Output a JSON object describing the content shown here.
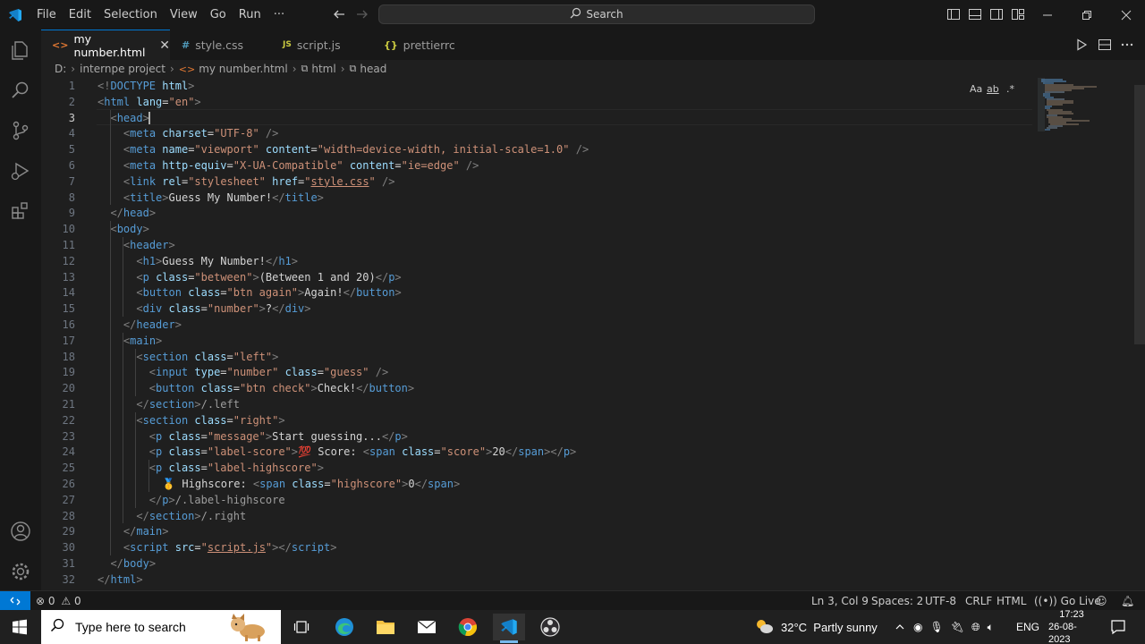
{
  "menu": [
    "File",
    "Edit",
    "Selection",
    "View",
    "Go",
    "Run",
    "···"
  ],
  "search": {
    "label": "Search"
  },
  "tabs": [
    {
      "label": "my number.html",
      "icon": "<>",
      "active": true
    },
    {
      "label": "style.css",
      "icon": "#"
    },
    {
      "label": "script.js",
      "icon": "JS"
    },
    {
      "label": "prettierrc",
      "icon": "{}"
    }
  ],
  "breadcrumb": [
    "D:",
    "internpe project",
    "my number.html",
    "html",
    "head"
  ],
  "find_widget": [
    "Aa",
    "ab",
    ".*"
  ],
  "code_lines": [
    [
      [
        "pu",
        "<!"
      ],
      [
        "tg",
        "DOCTYPE"
      ],
      [
        "tx",
        " "
      ],
      [
        "at",
        "html"
      ],
      [
        "pu",
        ">"
      ]
    ],
    [
      [
        "pu",
        "<"
      ],
      [
        "tg",
        "html"
      ],
      [
        "tx",
        " "
      ],
      [
        "at",
        "lang"
      ],
      [
        "tx",
        "="
      ],
      [
        "st",
        "\"en\""
      ],
      [
        "pu",
        ">"
      ]
    ],
    [
      [
        "tx",
        "  "
      ],
      [
        "pu",
        "<"
      ],
      [
        "tg",
        "head"
      ],
      [
        "pu",
        ">"
      ]
    ],
    [
      [
        "tx",
        "    "
      ],
      [
        "pu",
        "<"
      ],
      [
        "tg",
        "meta"
      ],
      [
        "tx",
        " "
      ],
      [
        "at",
        "charset"
      ],
      [
        "tx",
        "="
      ],
      [
        "st",
        "\"UTF-8\""
      ],
      [
        "tx",
        " "
      ],
      [
        "pu",
        "/>"
      ]
    ],
    [
      [
        "tx",
        "    "
      ],
      [
        "pu",
        "<"
      ],
      [
        "tg",
        "meta"
      ],
      [
        "tx",
        " "
      ],
      [
        "at",
        "name"
      ],
      [
        "tx",
        "="
      ],
      [
        "st",
        "\"viewport\""
      ],
      [
        "tx",
        " "
      ],
      [
        "at",
        "content"
      ],
      [
        "tx",
        "="
      ],
      [
        "st",
        "\"width=device-width, initial-scale=1.0\""
      ],
      [
        "tx",
        " "
      ],
      [
        "pu",
        "/>"
      ]
    ],
    [
      [
        "tx",
        "    "
      ],
      [
        "pu",
        "<"
      ],
      [
        "tg",
        "meta"
      ],
      [
        "tx",
        " "
      ],
      [
        "at",
        "http-equiv"
      ],
      [
        "tx",
        "="
      ],
      [
        "st",
        "\"X-UA-Compatible\""
      ],
      [
        "tx",
        " "
      ],
      [
        "at",
        "content"
      ],
      [
        "tx",
        "="
      ],
      [
        "st",
        "\"ie=edge\""
      ],
      [
        "tx",
        " "
      ],
      [
        "pu",
        "/>"
      ]
    ],
    [
      [
        "tx",
        "    "
      ],
      [
        "pu",
        "<"
      ],
      [
        "tg",
        "link"
      ],
      [
        "tx",
        " "
      ],
      [
        "at",
        "rel"
      ],
      [
        "tx",
        "="
      ],
      [
        "st",
        "\"stylesheet\""
      ],
      [
        "tx",
        " "
      ],
      [
        "at",
        "href"
      ],
      [
        "tx",
        "="
      ],
      [
        "st",
        "\""
      ],
      [
        "stu",
        "style.css"
      ],
      [
        "st",
        "\""
      ],
      [
        "tx",
        " "
      ],
      [
        "pu",
        "/>"
      ]
    ],
    [
      [
        "tx",
        "    "
      ],
      [
        "pu",
        "<"
      ],
      [
        "tg",
        "title"
      ],
      [
        "pu",
        ">"
      ],
      [
        "tx",
        "Guess My Number!"
      ],
      [
        "pu",
        "</"
      ],
      [
        "tg",
        "title"
      ],
      [
        "pu",
        ">"
      ]
    ],
    [
      [
        "tx",
        "  "
      ],
      [
        "pu",
        "</"
      ],
      [
        "tg",
        "head"
      ],
      [
        "pu",
        ">"
      ]
    ],
    [
      [
        "tx",
        "  "
      ],
      [
        "pu",
        "<"
      ],
      [
        "tg",
        "body"
      ],
      [
        "pu",
        ">"
      ]
    ],
    [
      [
        "tx",
        "    "
      ],
      [
        "pu",
        "<"
      ],
      [
        "tg",
        "header"
      ],
      [
        "pu",
        ">"
      ]
    ],
    [
      [
        "tx",
        "      "
      ],
      [
        "pu",
        "<"
      ],
      [
        "tg",
        "h1"
      ],
      [
        "pu",
        ">"
      ],
      [
        "tx",
        "Guess My Number!"
      ],
      [
        "pu",
        "</"
      ],
      [
        "tg",
        "h1"
      ],
      [
        "pu",
        ">"
      ]
    ],
    [
      [
        "tx",
        "      "
      ],
      [
        "pu",
        "<"
      ],
      [
        "tg",
        "p"
      ],
      [
        "tx",
        " "
      ],
      [
        "at",
        "class"
      ],
      [
        "tx",
        "="
      ],
      [
        "st",
        "\"between\""
      ],
      [
        "pu",
        ">"
      ],
      [
        "tx",
        "(Between 1 and 20)"
      ],
      [
        "pu",
        "</"
      ],
      [
        "tg",
        "p"
      ],
      [
        "pu",
        ">"
      ]
    ],
    [
      [
        "tx",
        "      "
      ],
      [
        "pu",
        "<"
      ],
      [
        "tg",
        "button"
      ],
      [
        "tx",
        " "
      ],
      [
        "at",
        "class"
      ],
      [
        "tx",
        "="
      ],
      [
        "st",
        "\"btn again\""
      ],
      [
        "pu",
        ">"
      ],
      [
        "tx",
        "Again!"
      ],
      [
        "pu",
        "</"
      ],
      [
        "tg",
        "button"
      ],
      [
        "pu",
        ">"
      ]
    ],
    [
      [
        "tx",
        "      "
      ],
      [
        "pu",
        "<"
      ],
      [
        "tg",
        "div"
      ],
      [
        "tx",
        " "
      ],
      [
        "at",
        "class"
      ],
      [
        "tx",
        "="
      ],
      [
        "st",
        "\"number\""
      ],
      [
        "pu",
        ">"
      ],
      [
        "tx",
        "?"
      ],
      [
        "pu",
        "</"
      ],
      [
        "tg",
        "div"
      ],
      [
        "pu",
        ">"
      ]
    ],
    [
      [
        "tx",
        "    "
      ],
      [
        "pu",
        "</"
      ],
      [
        "tg",
        "header"
      ],
      [
        "pu",
        ">"
      ]
    ],
    [
      [
        "tx",
        "    "
      ],
      [
        "pu",
        "<"
      ],
      [
        "tg",
        "main"
      ],
      [
        "pu",
        ">"
      ]
    ],
    [
      [
        "tx",
        "      "
      ],
      [
        "pu",
        "<"
      ],
      [
        "tg",
        "section"
      ],
      [
        "tx",
        " "
      ],
      [
        "at",
        "class"
      ],
      [
        "tx",
        "="
      ],
      [
        "st",
        "\"left\""
      ],
      [
        "pu",
        ">"
      ]
    ],
    [
      [
        "tx",
        "        "
      ],
      [
        "pu",
        "<"
      ],
      [
        "tg",
        "input"
      ],
      [
        "tx",
        " "
      ],
      [
        "at",
        "type"
      ],
      [
        "tx",
        "="
      ],
      [
        "st",
        "\"number\""
      ],
      [
        "tx",
        " "
      ],
      [
        "at",
        "class"
      ],
      [
        "tx",
        "="
      ],
      [
        "st",
        "\"guess\""
      ],
      [
        "tx",
        " "
      ],
      [
        "pu",
        "/>"
      ]
    ],
    [
      [
        "tx",
        "        "
      ],
      [
        "pu",
        "<"
      ],
      [
        "tg",
        "button"
      ],
      [
        "tx",
        " "
      ],
      [
        "at",
        "class"
      ],
      [
        "tx",
        "="
      ],
      [
        "st",
        "\"btn check\""
      ],
      [
        "pu",
        ">"
      ],
      [
        "tx",
        "Check!"
      ],
      [
        "pu",
        "</"
      ],
      [
        "tg",
        "button"
      ],
      [
        "pu",
        ">"
      ]
    ],
    [
      [
        "tx",
        "      "
      ],
      [
        "pu",
        "</"
      ],
      [
        "tg",
        "section"
      ],
      [
        "pu",
        ">"
      ],
      [
        "cm",
        "/.left"
      ]
    ],
    [
      [
        "tx",
        "      "
      ],
      [
        "pu",
        "<"
      ],
      [
        "tg",
        "section"
      ],
      [
        "tx",
        " "
      ],
      [
        "at",
        "class"
      ],
      [
        "tx",
        "="
      ],
      [
        "st",
        "\"right\""
      ],
      [
        "pu",
        ">"
      ]
    ],
    [
      [
        "tx",
        "        "
      ],
      [
        "pu",
        "<"
      ],
      [
        "tg",
        "p"
      ],
      [
        "tx",
        " "
      ],
      [
        "at",
        "class"
      ],
      [
        "tx",
        "="
      ],
      [
        "st",
        "\"message\""
      ],
      [
        "pu",
        ">"
      ],
      [
        "tx",
        "Start guessing..."
      ],
      [
        "pu",
        "</"
      ],
      [
        "tg",
        "p"
      ],
      [
        "pu",
        ">"
      ]
    ],
    [
      [
        "tx",
        "        "
      ],
      [
        "pu",
        "<"
      ],
      [
        "tg",
        "p"
      ],
      [
        "tx",
        " "
      ],
      [
        "at",
        "class"
      ],
      [
        "tx",
        "="
      ],
      [
        "st",
        "\"label-score\""
      ],
      [
        "pu",
        ">"
      ],
      [
        "emr",
        "💯"
      ],
      [
        "tx",
        " Score: "
      ],
      [
        "pu",
        "<"
      ],
      [
        "tg",
        "span"
      ],
      [
        "tx",
        " "
      ],
      [
        "at",
        "class"
      ],
      [
        "tx",
        "="
      ],
      [
        "st",
        "\"score\""
      ],
      [
        "pu",
        ">"
      ],
      [
        "tx",
        "20"
      ],
      [
        "pu",
        "</"
      ],
      [
        "tg",
        "span"
      ],
      [
        "pu",
        ">"
      ],
      [
        "pu",
        "</"
      ],
      [
        "tg",
        "p"
      ],
      [
        "pu",
        ">"
      ]
    ],
    [
      [
        "tx",
        "        "
      ],
      [
        "pu",
        "<"
      ],
      [
        "tg",
        "p"
      ],
      [
        "tx",
        " "
      ],
      [
        "at",
        "class"
      ],
      [
        "tx",
        "="
      ],
      [
        "st",
        "\"label-highscore\""
      ],
      [
        "pu",
        ">"
      ]
    ],
    [
      [
        "tx",
        "          "
      ],
      [
        "emy",
        "🥇"
      ],
      [
        "tx",
        " Highscore: "
      ],
      [
        "pu",
        "<"
      ],
      [
        "tg",
        "span"
      ],
      [
        "tx",
        " "
      ],
      [
        "at",
        "class"
      ],
      [
        "tx",
        "="
      ],
      [
        "st",
        "\"highscore\""
      ],
      [
        "pu",
        ">"
      ],
      [
        "tx",
        "0"
      ],
      [
        "pu",
        "</"
      ],
      [
        "tg",
        "span"
      ],
      [
        "pu",
        ">"
      ]
    ],
    [
      [
        "tx",
        "        "
      ],
      [
        "pu",
        "</"
      ],
      [
        "tg",
        "p"
      ],
      [
        "pu",
        ">"
      ],
      [
        "cm",
        "/.label-highscore"
      ]
    ],
    [
      [
        "tx",
        "      "
      ],
      [
        "pu",
        "</"
      ],
      [
        "tg",
        "section"
      ],
      [
        "pu",
        ">"
      ],
      [
        "cm",
        "/.right"
      ]
    ],
    [
      [
        "tx",
        "    "
      ],
      [
        "pu",
        "</"
      ],
      [
        "tg",
        "main"
      ],
      [
        "pu",
        ">"
      ]
    ],
    [
      [
        "tx",
        "    "
      ],
      [
        "pu",
        "<"
      ],
      [
        "tg",
        "script"
      ],
      [
        "tx",
        " "
      ],
      [
        "at",
        "src"
      ],
      [
        "tx",
        "="
      ],
      [
        "st",
        "\""
      ],
      [
        "stu",
        "script.js"
      ],
      [
        "st",
        "\""
      ],
      [
        "pu",
        ">"
      ],
      [
        "pu",
        "</"
      ],
      [
        "tg",
        "script"
      ],
      [
        "pu",
        ">"
      ]
    ],
    [
      [
        "tx",
        "  "
      ],
      [
        "pu",
        "</"
      ],
      [
        "tg",
        "body"
      ],
      [
        "pu",
        ">"
      ]
    ],
    [
      [
        "pu",
        "</"
      ],
      [
        "tg",
        "html"
      ],
      [
        "pu",
        ">"
      ]
    ]
  ],
  "current_line": 3,
  "status": {
    "errors": "0",
    "warnings": "0",
    "position": "Ln 3, Col 9",
    "spaces": "Spaces: 2",
    "encoding": "UTF-8",
    "eol": "CRLF",
    "language": "HTML",
    "golive": "Go Live"
  },
  "taskbar": {
    "search_placeholder": "Type here to search",
    "weather": "32°C  Partly sunny",
    "lang": "ENG",
    "time": "17:23",
    "date": "26-08-2023"
  },
  "colors": {
    "accent": "#0078d4",
    "tag": "#569cd6",
    "attr": "#9cdcfe",
    "string": "#ce9178"
  }
}
